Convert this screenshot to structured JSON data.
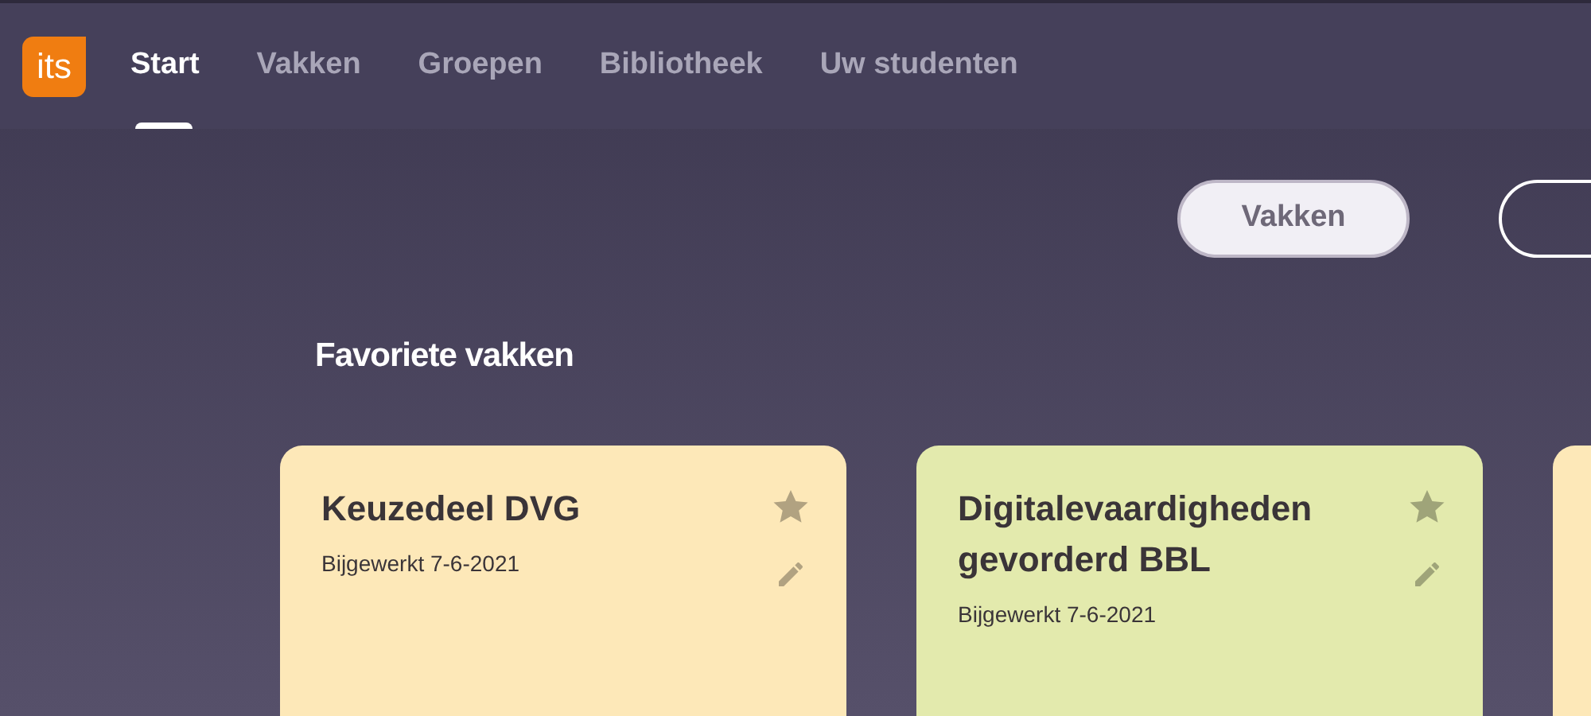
{
  "nav": {
    "logo": "its",
    "tabs": [
      {
        "label": "Start",
        "selected": true
      },
      {
        "label": "Vakken",
        "selected": false
      },
      {
        "label": "Groepen",
        "selected": false
      },
      {
        "label": "Bibliotheek",
        "selected": false
      },
      {
        "label": "Uw studenten",
        "selected": false
      }
    ]
  },
  "view_toggle": [
    {
      "label": "Vakken",
      "selected": true
    },
    {
      "selected": false
    }
  ],
  "section_title": "Favoriete vakken",
  "cards": [
    {
      "title": "Keuzedeel DVG",
      "updated": "Bijgewerkt 7-6-2021",
      "color": "#fde8b8"
    },
    {
      "title": "Digitalevaardigheden gevorderd BBL",
      "updated": "Bijgewerkt 7-6-2021",
      "color": "#e3eaad"
    },
    {
      "color": "#fde8b8"
    }
  ]
}
